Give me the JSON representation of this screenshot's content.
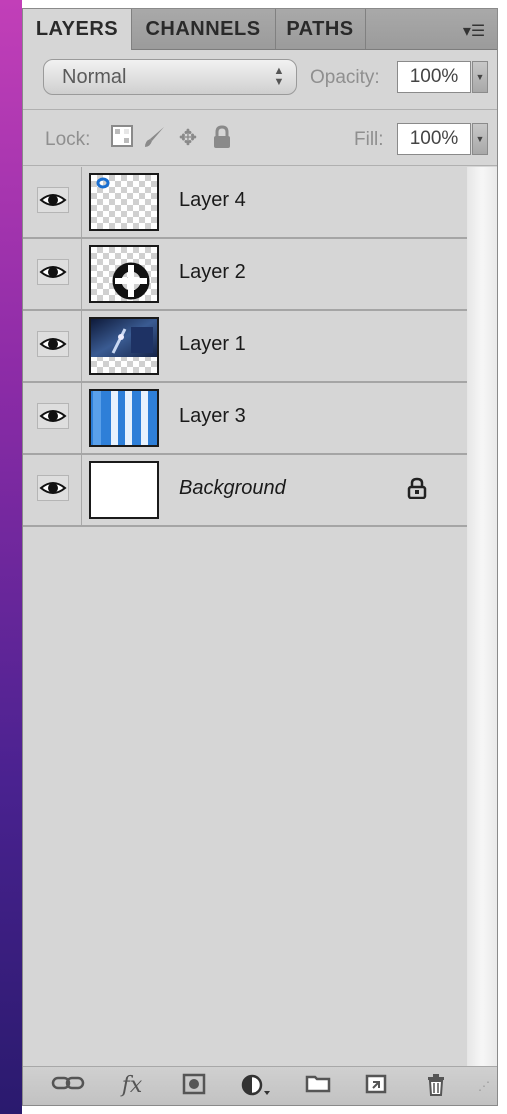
{
  "tabs": [
    {
      "label": "LAYERS",
      "active": true
    },
    {
      "label": "CHANNELS",
      "active": false
    },
    {
      "label": "PATHS",
      "active": false
    }
  ],
  "panel_menu_icon": "panel-menu-icon",
  "blend_mode": {
    "value": "Normal"
  },
  "opacity": {
    "label": "Opacity:",
    "value": "100%"
  },
  "lock": {
    "label": "Lock:",
    "icons": [
      "lock-transparent-pixels-icon",
      "lock-image-pixels-icon",
      "lock-position-icon",
      "lock-all-icon"
    ]
  },
  "fill": {
    "label": "Fill:",
    "value": "100%"
  },
  "layers": [
    {
      "name": "Layer 4",
      "visible": true,
      "locked": false
    },
    {
      "name": "Layer 2",
      "visible": true,
      "locked": false
    },
    {
      "name": "Layer 1",
      "visible": true,
      "locked": false
    },
    {
      "name": "Layer 3",
      "visible": true,
      "locked": false
    },
    {
      "name": "Background",
      "visible": true,
      "locked": true
    }
  ],
  "footer_icons": [
    "link-layers-icon",
    "layer-style-fx-icon",
    "layer-mask-icon",
    "adjustment-layer-icon",
    "new-group-icon",
    "new-layer-icon",
    "trash-icon"
  ],
  "colors": {
    "accent_left": "#8a2ba6",
    "panel_bg": "#d6d6d6",
    "thumb_blue": "#2e7fd8"
  }
}
